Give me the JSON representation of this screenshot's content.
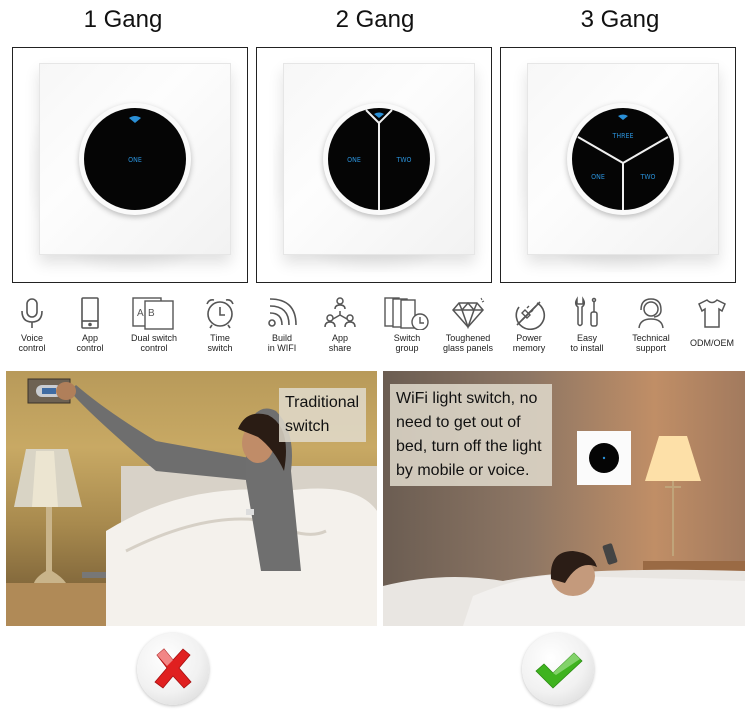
{
  "products": [
    {
      "title": "1 Gang",
      "buttons": [
        "ONE"
      ]
    },
    {
      "title": "2 Gang",
      "buttons": [
        "ONE",
        "TWO"
      ]
    },
    {
      "title": "3 Gang",
      "buttons": [
        "ONE",
        "TWO",
        "THREE"
      ]
    }
  ],
  "features": [
    {
      "icon": "microphone-icon",
      "line1": "Voice",
      "line2": "control"
    },
    {
      "icon": "smartphone-icon",
      "line1": "App",
      "line2": "control"
    },
    {
      "icon": "dual-switch-ab-icon",
      "line1": "Dual switch",
      "line2": "control"
    },
    {
      "icon": "alarm-clock-icon",
      "line1": "Time",
      "line2": "switch"
    },
    {
      "icon": "wifi-signal-icon",
      "line1": "Build",
      "line2": "in WIFI"
    },
    {
      "icon": "share-users-icon",
      "line1": "App",
      "line2": "share"
    },
    {
      "icon": "switch-group-clock-icon",
      "line1": "Switch",
      "line2": "group"
    },
    {
      "icon": "diamond-icon",
      "line1": "Toughened",
      "line2": "glass panels"
    },
    {
      "icon": "power-plug-icon",
      "line1": "Power",
      "line2": "memory"
    },
    {
      "icon": "wrench-screwdriver-icon",
      "line1": "Easy",
      "line2": "to install"
    },
    {
      "icon": "headset-support-icon",
      "line1": "Technical",
      "line2": "support"
    },
    {
      "icon": "tshirt-icon",
      "line1": "ODM/OEM",
      "line2": ""
    }
  ],
  "comparison": {
    "left_caption": [
      "Traditional",
      "switch"
    ],
    "right_caption": [
      "WiFi light switch, no",
      "need to get out of",
      "bed, turn off the light",
      "by mobile or voice."
    ],
    "left_verdict": "cross-mark",
    "right_verdict": "check-mark",
    "colors": {
      "cross": "#e02020",
      "check": "#3fb31f",
      "led": "#2a8fd6"
    }
  }
}
